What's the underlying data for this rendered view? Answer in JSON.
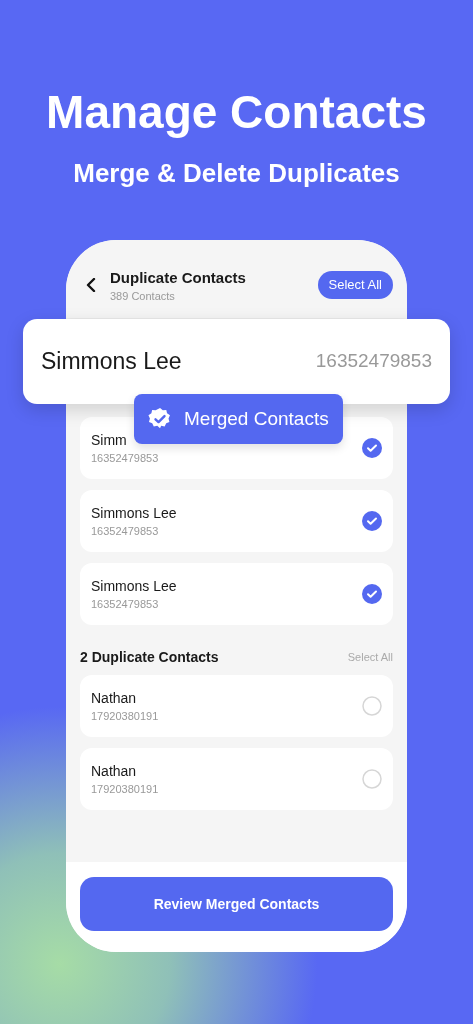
{
  "hero": {
    "title": "Manage Contacts",
    "subtitle": "Merge & Delete Duplicates"
  },
  "screen": {
    "title": "Duplicate Contacts",
    "subtitle": "389 Contacts",
    "select_all": "Select All",
    "groups": [
      {
        "contacts": [
          {
            "name": "Simm",
            "phone": "16352479853",
            "selected": true
          },
          {
            "name": "Simmons Lee",
            "phone": "16352479853",
            "selected": true
          },
          {
            "name": "Simmons Lee",
            "phone": "16352479853",
            "selected": true
          }
        ]
      },
      {
        "heading": "2 Duplicate Contacts",
        "select_all": "Select All",
        "contacts": [
          {
            "name": "Nathan",
            "phone": "17920380191",
            "selected": false
          },
          {
            "name": "Nathan",
            "phone": "17920380191",
            "selected": false
          }
        ]
      }
    ],
    "primary_button": "Review Merged Contacts"
  },
  "popup_card": {
    "name": "Simmons Lee",
    "phone": "16352479853"
  },
  "badge": {
    "label": "Merged Contacts"
  }
}
